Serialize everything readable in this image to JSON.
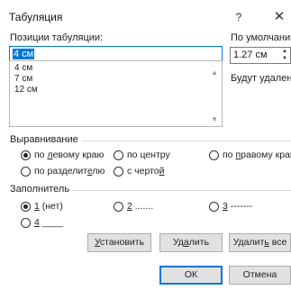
{
  "window": {
    "title": "Табуляция",
    "help_label": "?",
    "close_label": "✕"
  },
  "tab_positions": {
    "label": "Позиции табуляции:",
    "value": "4 см",
    "list": [
      "4 см",
      "7 см",
      "12 см"
    ]
  },
  "default": {
    "label": "По умолчанию:",
    "value": "1.27 см"
  },
  "to_be_cleared": {
    "label": "Будут удалены:"
  },
  "alignment": {
    "title": "Выравнивание",
    "options": [
      {
        "pre": "по ",
        "u": "л",
        "post": "евому краю",
        "checked": true
      },
      {
        "pre": "по центру",
        "u": "",
        "post": "",
        "checked": false
      },
      {
        "pre": "по ",
        "u": "п",
        "post": "равому краю",
        "checked": false
      },
      {
        "pre": "по разделит",
        "u": "е",
        "post": "лю",
        "checked": false
      },
      {
        "pre": "с черто",
        "u": "й",
        "post": "",
        "checked": false
      }
    ]
  },
  "leader": {
    "title": "Заполнитель",
    "options": [
      {
        "pre": "",
        "u": "1",
        "post": " (нет)",
        "checked": true
      },
      {
        "pre": "",
        "u": "2",
        "post": " .......",
        "checked": false
      },
      {
        "pre": "",
        "u": "3",
        "post": " -------",
        "checked": false
      },
      {
        "pre": "",
        "u": "4",
        "post": " ____",
        "checked": false
      }
    ]
  },
  "buttons": {
    "set": {
      "pre": "",
      "u": "У",
      "post": "становить"
    },
    "clear": {
      "pre": "Уд",
      "u": "а",
      "post": "лить"
    },
    "clear_all": {
      "pre": "Удалит",
      "u": "ь",
      "post": " все"
    },
    "ok": "ОК",
    "cancel": "Отмена"
  },
  "icons": {
    "scroll_up": "▲",
    "scroll_down": "▼",
    "spin_up": "▲",
    "spin_down": "▼"
  }
}
